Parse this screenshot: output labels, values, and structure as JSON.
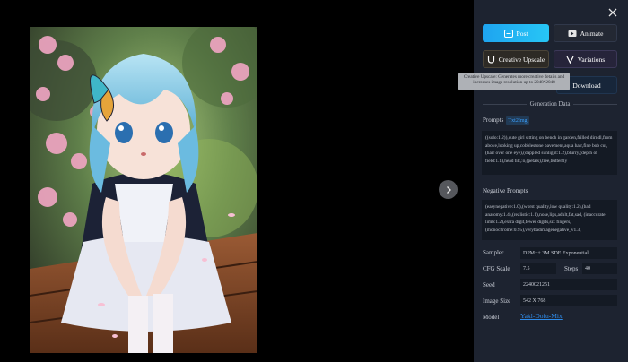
{
  "viewer": {
    "image_alt": "Anime girl with blue hair sitting on a wooden bench among pink cherry blossoms",
    "next_icon": "chevron-right-icon"
  },
  "panel": {
    "close_icon": "close-icon",
    "buttons": {
      "post": "Post",
      "animate": "Animate",
      "creative_upscale": "Creative Upscale",
      "variations": "Variations",
      "download": "Download"
    },
    "tooltip": "Creative Upscale: Generates more creative details and increases image resolution up to 2048*2048",
    "generation_data_title": "Generation Data",
    "prompts_label": "Prompts",
    "prompt_tag": "Txt2Img",
    "prompt_text": "((solo:1.2)),cute girl sitting on bench in garden,frilled dirndl,from above,looking up,cobblestone pavement,aqua hair,fine bob cut,(hair over one eye),(dappled sunlight:1.2),blurry,(depth of field:1.1),head tilt,:o,(petals),tree,butterfly",
    "negative_label": "Negative Prompts",
    "negative_text": "(easynegative:1.0),(worst quality,low quality:1.2),(bad anatomy:1.4),(realistic:1.1),nose,lips,adult,fat,sad, (inaccurate limb:1.2),extra digit,fewer digits,six fingers,(monochrome:0.95),verybadimagenegative_v1.3,",
    "sampler_label": "Sampler",
    "sampler_value": "DPM++ 3M SDE Exponential",
    "cfg_label": "CFG Scale",
    "cfg_value": "7.5",
    "steps_label": "Steps",
    "steps_value": "40",
    "seed_label": "Seed",
    "seed_value": "2240021251",
    "size_label": "Image Size",
    "size_value": "542 X 768",
    "model_label": "Model",
    "model_value": "Yakl-Dofu-Mix"
  }
}
